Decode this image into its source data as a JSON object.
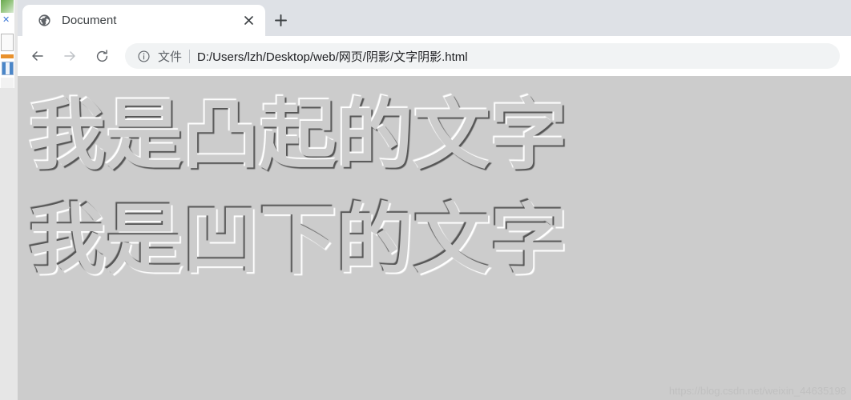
{
  "browser": {
    "tab": {
      "favicon": "globe-icon",
      "title": "Document",
      "close_label": "×"
    },
    "new_tab_label": "+",
    "toolbar": {
      "back_label": "←",
      "forward_label": "→",
      "reload_label": "⟳",
      "omnibox": {
        "info_icon": "info-circle-icon",
        "scheme_label": "文件",
        "url": "D:/Users/lzh/Desktop/web/网页/阴影/文字阴影.html"
      }
    }
  },
  "page": {
    "background_color": "#cccccc",
    "lines": [
      {
        "text": "我是凸起的文字",
        "effect": "raised"
      },
      {
        "text": "我是凹下的文字",
        "effect": "sunken"
      }
    ],
    "watermark": "https://blog.csdn.net/weixin_44635198"
  }
}
